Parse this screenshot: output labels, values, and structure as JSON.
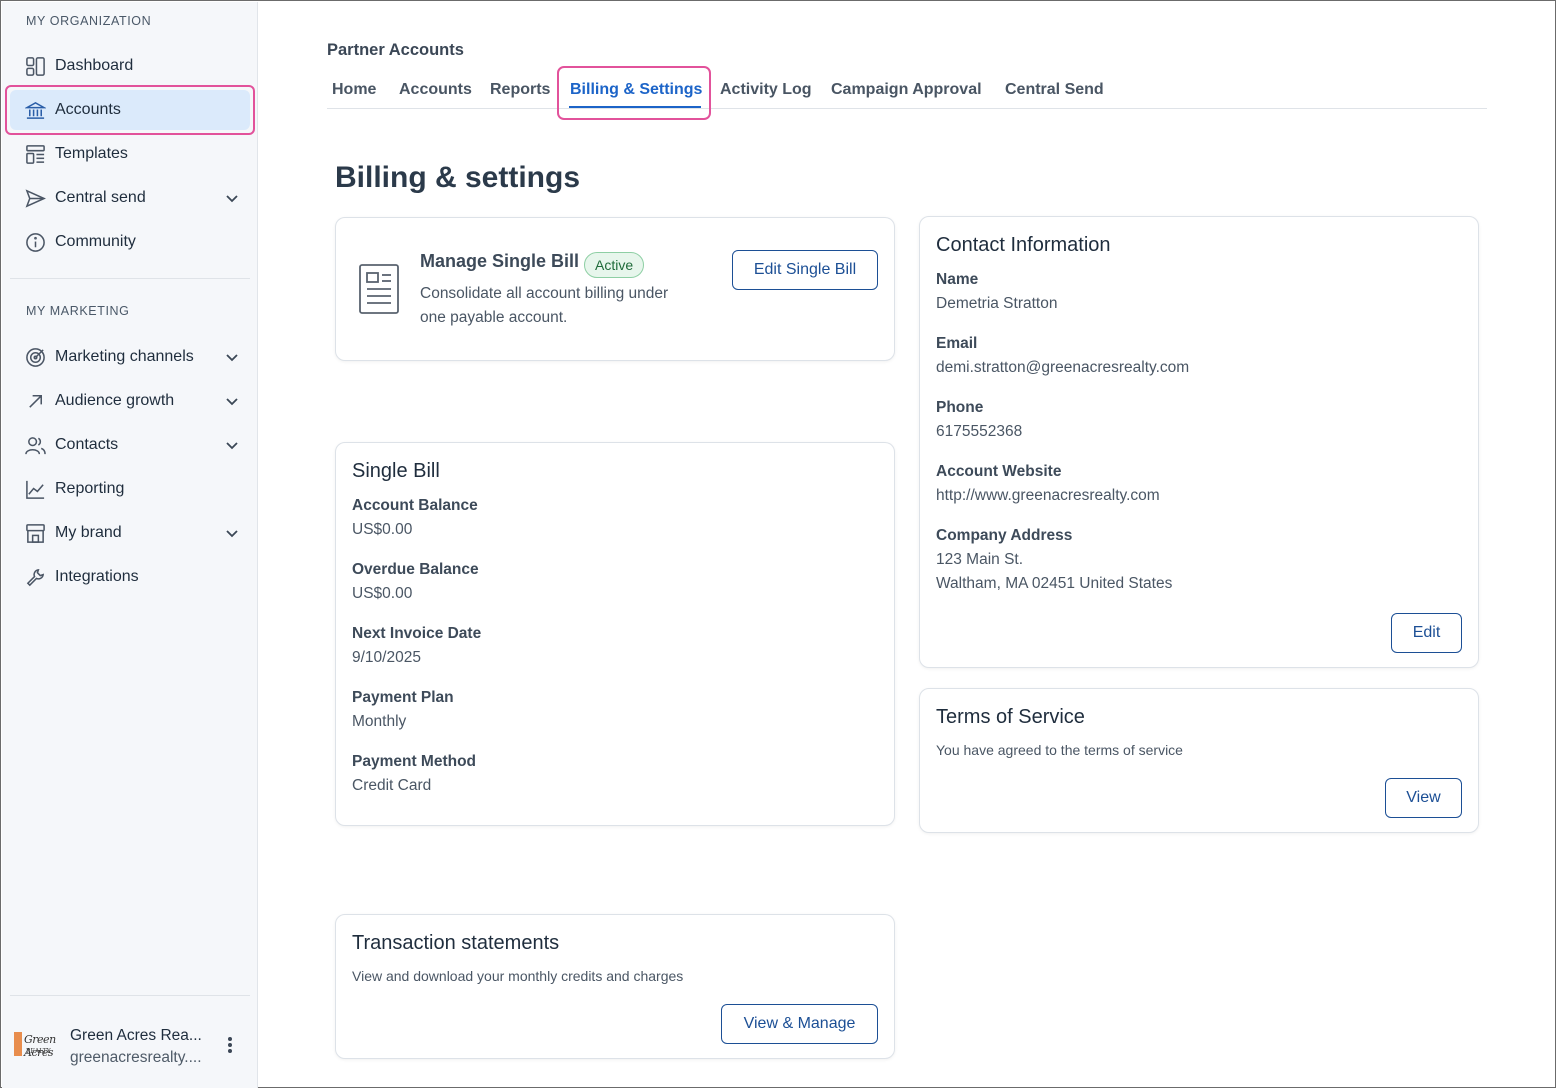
{
  "sidebar": {
    "org_section_label": "MY ORGANIZATION",
    "marketing_section_label": "MY MARKETING",
    "org_items": [
      {
        "label": "Dashboard",
        "icon": "dashboard-icon"
      },
      {
        "label": "Accounts",
        "icon": "bank-icon"
      },
      {
        "label": "Templates",
        "icon": "templates-icon"
      },
      {
        "label": "Central send",
        "icon": "send-icon"
      },
      {
        "label": "Community",
        "icon": "info-icon"
      }
    ],
    "marketing_items": [
      {
        "label": "Marketing channels",
        "icon": "target-icon"
      },
      {
        "label": "Audience growth",
        "icon": "arrow-up-right-icon"
      },
      {
        "label": "Contacts",
        "icon": "contacts-icon"
      },
      {
        "label": "Reporting",
        "icon": "chart-icon"
      },
      {
        "label": "My brand",
        "icon": "storefront-icon"
      },
      {
        "label": "Integrations",
        "icon": "wrench-icon"
      }
    ],
    "active_item": "Accounts",
    "footer": {
      "org_name": "Green Acres Rea...",
      "org_domain": "greenacresrealty....",
      "logo_text": "Green Acres",
      "logo_sub": "REALTY"
    }
  },
  "header": {
    "breadcrumb": "Partner Accounts",
    "tabs": [
      "Home",
      "Accounts",
      "Reports",
      "Billing & Settings",
      "Activity Log",
      "Campaign Approval",
      "Central Send"
    ],
    "active_tab": "Billing & Settings"
  },
  "page_title": "Billing & settings",
  "manage_single_bill": {
    "title": "Manage Single Bill",
    "badge": "Active",
    "description_line1": "Consolidate all account billing under",
    "description_line2": "one payable account.",
    "button": "Edit Single Bill"
  },
  "single_bill": {
    "title": "Single Bill",
    "fields": [
      {
        "label": "Account Balance",
        "value": "US$0.00"
      },
      {
        "label": "Overdue Balance",
        "value": "US$0.00"
      },
      {
        "label": "Next Invoice Date",
        "value": "9/10/2025"
      },
      {
        "label": "Payment Plan",
        "value": "Monthly"
      },
      {
        "label": "Payment Method",
        "value": "Credit Card"
      }
    ]
  },
  "contact": {
    "title": "Contact Information",
    "fields": [
      {
        "label": "Name",
        "value": "Demetria Stratton"
      },
      {
        "label": "Email",
        "value": "demi.stratton@greenacresrealty.com"
      },
      {
        "label": "Phone",
        "value": "6175552368"
      },
      {
        "label": "Account Website",
        "value": "http://www.greenacresrealty.com"
      }
    ],
    "address_label": "Company Address",
    "address_line1": "123 Main St.",
    "address_line2": "Waltham, MA 02451 United States",
    "button": "Edit"
  },
  "terms": {
    "title": "Terms of Service",
    "text": "You have agreed to the terms of service",
    "button": "View"
  },
  "transactions": {
    "title": "Transaction statements",
    "text": "View and download your monthly credits and charges",
    "button": "View & Manage"
  },
  "colors": {
    "accent": "#1c64c8",
    "highlight": "#e2529b",
    "active_bg": "#dbeafb",
    "badge_bg": "#e7f6ec"
  }
}
